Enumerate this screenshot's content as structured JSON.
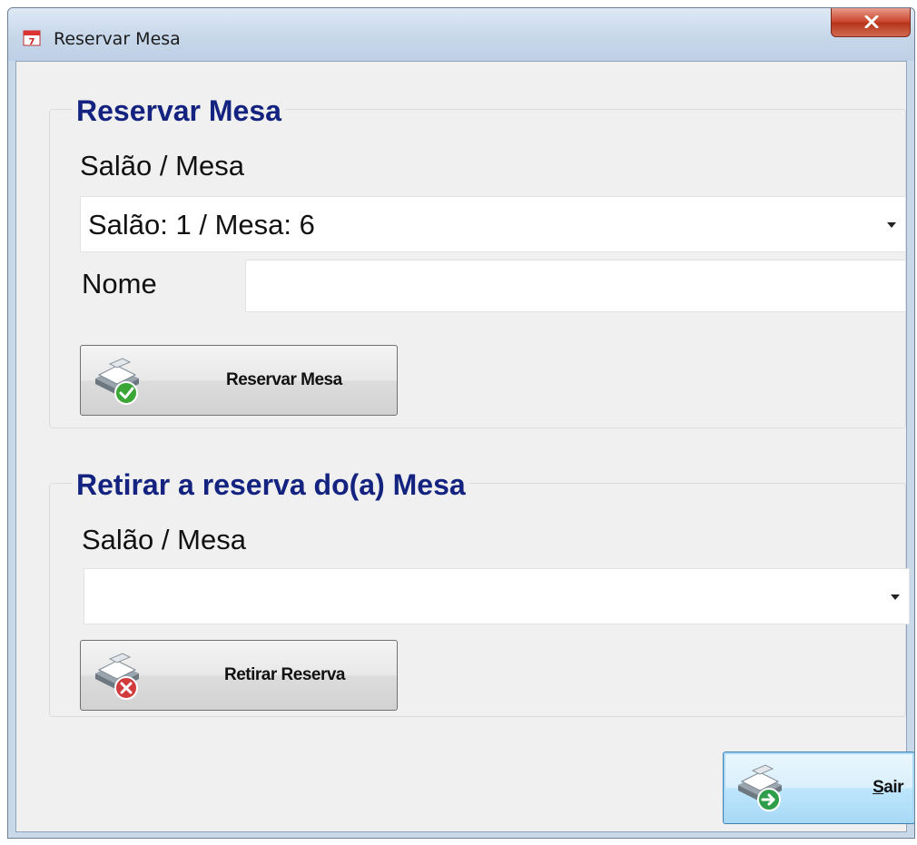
{
  "window": {
    "title": "Reservar Mesa",
    "close_symbol": "x"
  },
  "reserve_group": {
    "title": "Reservar Mesa",
    "salao_mesa_label": "Salão / Mesa",
    "salao_mesa_value": "Salão: 1 / Mesa: 6",
    "nome_label": "Nome",
    "nome_value": "",
    "button_label": "Reservar Mesa",
    "button_icon": "tray-check-icon"
  },
  "remove_group": {
    "title": "Retirar a reserva do(a) Mesa",
    "salao_mesa_label": "Salão / Mesa",
    "salao_mesa_value": "",
    "button_label": "Retirar Reserva",
    "button_icon": "tray-remove-icon"
  },
  "footer": {
    "exit_label": "Sair",
    "exit_icon": "tray-exit-icon"
  },
  "colors": {
    "group_title": "#13237f",
    "check_green": "#3aa635",
    "remove_red": "#d23b3b",
    "exit_green": "#2f9e4a"
  }
}
